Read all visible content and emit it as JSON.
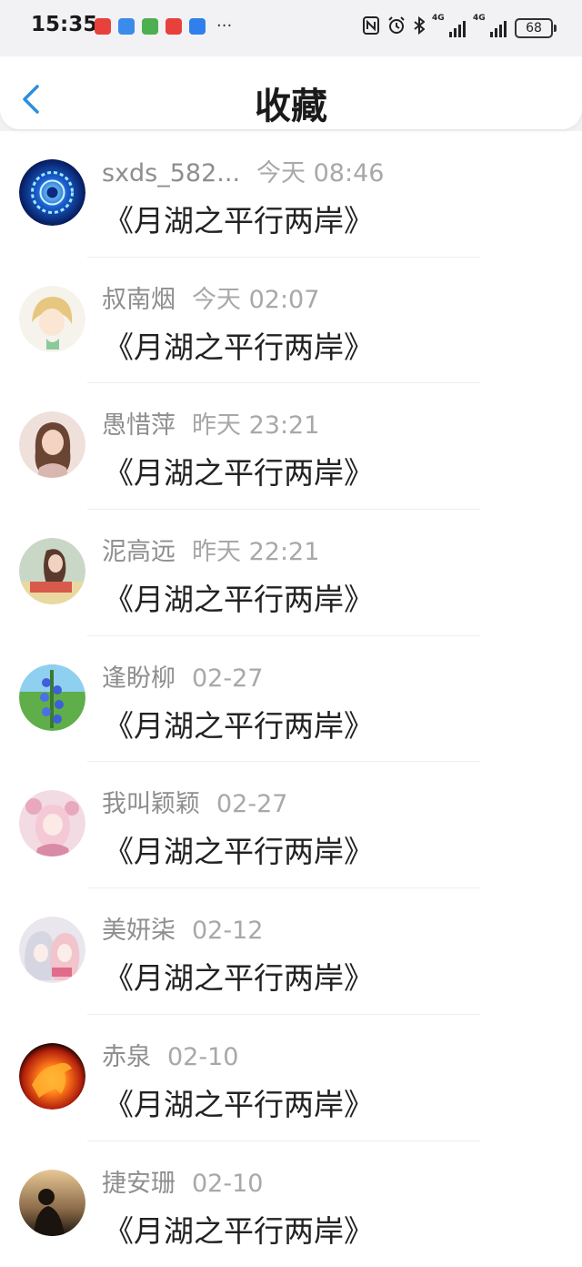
{
  "status_bar": {
    "time": "15:35",
    "battery": "68",
    "app_icons": [
      {
        "name": "huawei-app-icon",
        "color": "#e8413c"
      },
      {
        "name": "browser-app-icon",
        "color": "#3b8bea"
      },
      {
        "name": "panda-app-icon",
        "color": "#4caf50"
      },
      {
        "name": "huawei-app-icon-2",
        "color": "#e8413c"
      },
      {
        "name": "search-app-icon",
        "color": "#2f80ed"
      }
    ],
    "more": "···"
  },
  "header": {
    "title": "收藏",
    "accent": "#2a8fe0"
  },
  "favorites": [
    {
      "name": "sxds_582...",
      "time": "今天 08:46",
      "book": "《月湖之平行两岸》",
      "avatar": "blue-mandala"
    },
    {
      "name": "叔南烟",
      "time": "今天 02:07",
      "book": "《月湖之平行两岸》",
      "avatar": "cartoon-girl"
    },
    {
      "name": "愚惜萍",
      "time": "昨天 23:21",
      "book": "《月湖之平行两岸》",
      "avatar": "little-girl-photo"
    },
    {
      "name": "泥高远",
      "time": "昨天 22:21",
      "book": "《月湖之平行两岸》",
      "avatar": "girl-poster"
    },
    {
      "name": "逢盼柳",
      "time": "02-27",
      "book": "《月湖之平行两岸》",
      "avatar": "blue-flowers"
    },
    {
      "name": "我叫颖颖",
      "time": "02-27",
      "book": "《月湖之平行两岸》",
      "avatar": "anime-pink"
    },
    {
      "name": "美妍柒",
      "time": "02-12",
      "book": "《月湖之平行两岸》",
      "avatar": "anime-duo"
    },
    {
      "name": "赤泉",
      "time": "02-10",
      "book": "《月湖之平行两岸》",
      "avatar": "fire-horse"
    },
    {
      "name": "捷安珊",
      "time": "02-10",
      "book": "《月湖之平行两岸》",
      "avatar": "sunset-silhouette"
    }
  ]
}
